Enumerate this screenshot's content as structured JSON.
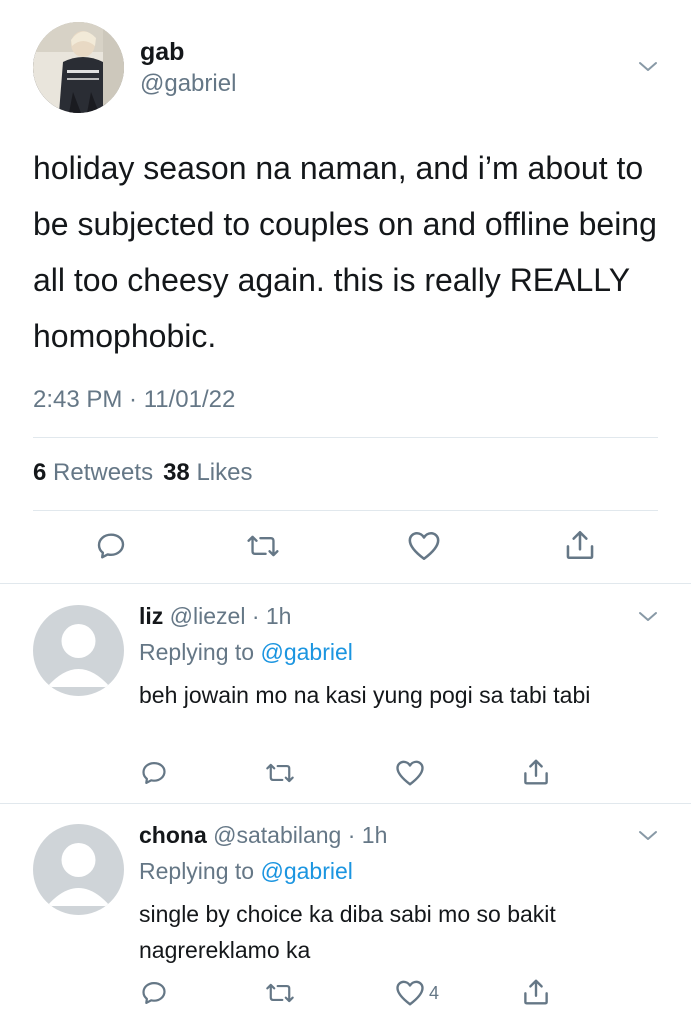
{
  "main_tweet": {
    "display_name": "gab",
    "handle": "@gabriel",
    "text": "holiday season na naman, and i’m about to be subjected to couples on and offline being all too cheesy again. this is really REALLY homophobic.",
    "timestamp": "2:43 PM · 11/01/22",
    "retweets_count": "6",
    "retweets_label": "Retweets",
    "likes_count": "38",
    "likes_label": "Likes"
  },
  "replies": [
    {
      "display_name": "liz",
      "handle": "@liezel",
      "separator": "·",
      "time": "1h",
      "replying_prefix": "Replying to",
      "replying_to": "@gabriel",
      "text": "beh jowain mo na kasi yung pogi sa tabi tabi",
      "like_count": ""
    },
    {
      "display_name": "chona",
      "handle": "@satabilang",
      "separator": "·",
      "time": "1h",
      "replying_prefix": "Replying to",
      "replying_to": "@gabriel",
      "text": "single by choice ka diba sabi mo so bakit nagrereklamo ka",
      "like_count": "4"
    }
  ],
  "icons": [
    "reply-icon",
    "retweet-icon",
    "like-icon",
    "share-icon",
    "chevron-down-icon"
  ],
  "colors": {
    "text": "#14171a",
    "secondary": "#657786",
    "link": "#1b95e0",
    "divider": "#e1e8ed",
    "placeholder_avatar": "#cfd4d8"
  }
}
